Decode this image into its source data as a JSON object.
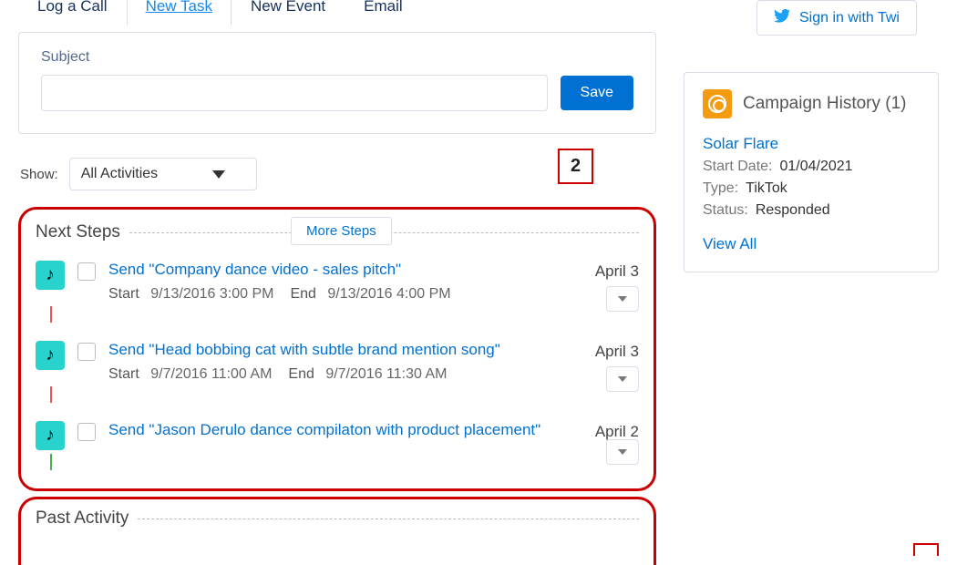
{
  "tabs": {
    "logCall": "Log a Call",
    "newTask": "New Task",
    "newEvent": "New Event",
    "email": "Email"
  },
  "form": {
    "subjectLabel": "Subject",
    "saveLabel": "Save"
  },
  "filter": {
    "showLabel": "Show:",
    "selected": "All Activities"
  },
  "callouts": {
    "two": "2"
  },
  "nextSteps": {
    "title": "Next Steps",
    "moreSteps": "More Steps",
    "items": [
      {
        "title": "Send \"Company dance video - sales pitch\"",
        "startLabel": "Start",
        "start": "9/13/2016 3:00 PM",
        "endLabel": "End",
        "end": "9/13/2016 4:00 PM",
        "date": "April 3"
      },
      {
        "title": "Send \"Head bobbing cat with subtle brand mention song\"",
        "startLabel": "Start",
        "start": "9/7/2016 11:00 AM",
        "endLabel": "End",
        "end": "9/7/2016 11:30 AM",
        "date": "April 3"
      },
      {
        "title": "Send \"Jason Derulo dance compilaton with product placement\"",
        "date": "April 2"
      }
    ]
  },
  "pastActivity": {
    "title": "Past Activity"
  },
  "twitter": {
    "signIn": "Sign in with Twi"
  },
  "campaign": {
    "header": "Campaign History (1)",
    "link": "Solar Flare",
    "startDateLabel": "Start Date:",
    "startDate": "01/04/2021",
    "typeLabel": "Type:",
    "type": "TikTok",
    "statusLabel": "Status:",
    "status": "Responded",
    "viewAll": "View All"
  }
}
